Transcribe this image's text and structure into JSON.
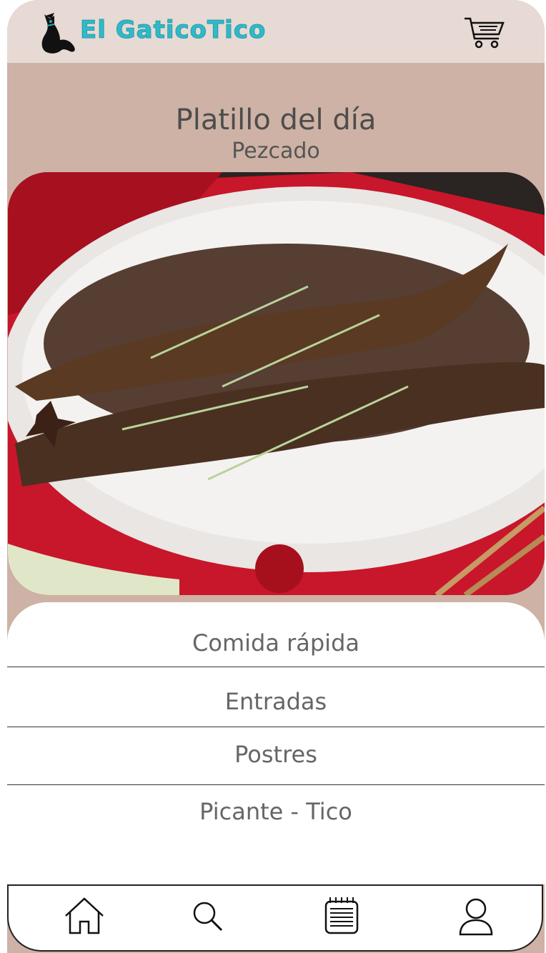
{
  "header": {
    "brand": "El GaticoTico",
    "icons": {
      "logo": "cat-logo-icon",
      "cart": "shopping-cart-icon"
    }
  },
  "featured": {
    "title": "Platillo del día",
    "subtitle": "Pezcado"
  },
  "menu": {
    "items": [
      {
        "label": "Comida rápida"
      },
      {
        "label": "Entradas"
      },
      {
        "label": "Postres"
      },
      {
        "label": "Picante - Tico"
      }
    ]
  },
  "bottom_nav": {
    "items": [
      {
        "icon": "home-icon"
      },
      {
        "icon": "search-icon"
      },
      {
        "icon": "menu-list-icon"
      },
      {
        "icon": "user-icon"
      }
    ]
  },
  "colors": {
    "brand": "#33b8c7",
    "header_bg": "#e7d9d3",
    "body_bg": "#cdb2a5",
    "card_bg": "#ffffff"
  }
}
